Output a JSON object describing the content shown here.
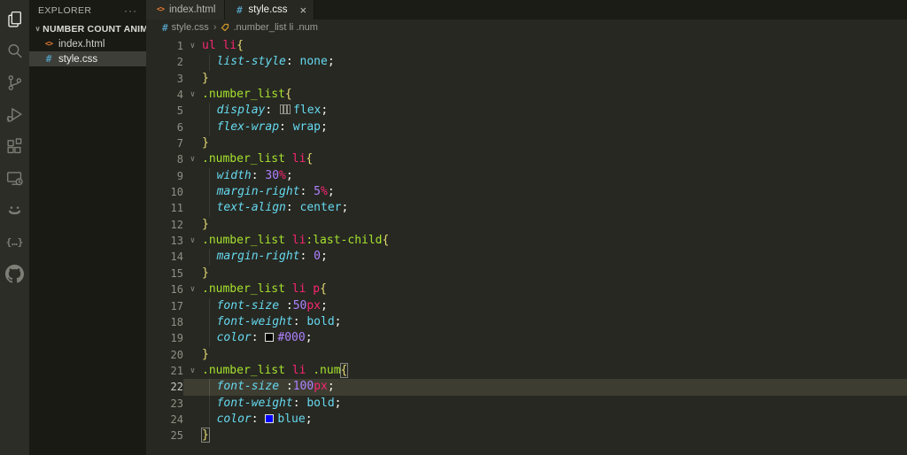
{
  "glyphs": {
    "css": "#",
    "html": "<>"
  },
  "colors": {
    "editor_bg": "#272822",
    "activity_bar_bg": "#2c2d27",
    "sidebar_bg": "#191a14",
    "line_highlight": "#3e3d32",
    "tag": "#f92672",
    "class": "#a6e22e",
    "bracket": "#e6db74",
    "property": "#66d9ef",
    "value_keyword": "#66d9ef",
    "number": "#ae81ff",
    "unit": "#f92672",
    "css_icon_blue": "#519aba",
    "html_icon_orange": "#e37933",
    "swatch_black": "#000000",
    "swatch_blue": "#0000ff"
  },
  "activity_bar": {
    "items": [
      {
        "name": "explorer",
        "active": true
      },
      {
        "name": "search",
        "active": false
      },
      {
        "name": "source-control",
        "active": false
      },
      {
        "name": "run-debug",
        "active": false
      },
      {
        "name": "extensions",
        "active": false
      },
      {
        "name": "live-server",
        "active": false
      },
      {
        "name": "smiley",
        "active": false
      },
      {
        "name": "braces",
        "active": false
      },
      {
        "name": "github",
        "active": false
      }
    ]
  },
  "sidebar": {
    "header": "EXPLORER",
    "more_label": "···",
    "folder": {
      "chevron": "∨",
      "name": "NUMBER COUNT ANIMA..."
    },
    "files": [
      {
        "name": "index.html",
        "icon": "html",
        "selected": false
      },
      {
        "name": "style.css",
        "icon": "css",
        "selected": true
      }
    ]
  },
  "tabs": [
    {
      "label": "index.html",
      "icon": "html",
      "active": false,
      "close_label": ""
    },
    {
      "label": "style.css",
      "icon": "css",
      "active": true,
      "close_label": "×"
    }
  ],
  "breadcrumb": {
    "file": "style.css",
    "separator": "›",
    "path": ".number_list li .num"
  },
  "editor": {
    "active_line": 22,
    "fold_glyph": "∨",
    "lines": [
      {
        "n": 1,
        "fold": true,
        "ind": false,
        "tokens": [
          [
            "tag",
            "ul li"
          ],
          [
            "brk",
            "{"
          ]
        ]
      },
      {
        "n": 2,
        "fold": false,
        "ind": true,
        "tokens": [
          [
            "prop",
            "list-style"
          ],
          [
            "pun",
            ": "
          ],
          [
            "val",
            "none"
          ],
          [
            "pun",
            ";"
          ]
        ]
      },
      {
        "n": 3,
        "fold": false,
        "ind": false,
        "tokens": [
          [
            "brk",
            "}"
          ]
        ]
      },
      {
        "n": 4,
        "fold": true,
        "ind": false,
        "tokens": [
          [
            "cls",
            ".number_list"
          ],
          [
            "brk",
            "{"
          ]
        ]
      },
      {
        "n": 5,
        "fold": false,
        "ind": true,
        "tokens": [
          [
            "prop",
            "display"
          ],
          [
            "pun",
            ": "
          ],
          [
            "flexicon",
            ""
          ],
          [
            "val",
            "flex"
          ],
          [
            "pun",
            ";"
          ]
        ]
      },
      {
        "n": 6,
        "fold": false,
        "ind": true,
        "tokens": [
          [
            "prop",
            "flex-wrap"
          ],
          [
            "pun",
            ": "
          ],
          [
            "val",
            "wrap"
          ],
          [
            "pun",
            ";"
          ]
        ]
      },
      {
        "n": 7,
        "fold": false,
        "ind": false,
        "tokens": [
          [
            "brk",
            "}"
          ]
        ]
      },
      {
        "n": 8,
        "fold": true,
        "ind": false,
        "tokens": [
          [
            "cls",
            ".number_list"
          ],
          [
            "pun",
            " "
          ],
          [
            "tag",
            "li"
          ],
          [
            "brk",
            "{"
          ]
        ]
      },
      {
        "n": 9,
        "fold": false,
        "ind": true,
        "tokens": [
          [
            "prop",
            "width"
          ],
          [
            "pun",
            ": "
          ],
          [
            "num",
            "30"
          ],
          [
            "unit",
            "%"
          ],
          [
            "pun",
            ";"
          ]
        ]
      },
      {
        "n": 10,
        "fold": false,
        "ind": true,
        "tokens": [
          [
            "prop",
            "margin-right"
          ],
          [
            "pun",
            ": "
          ],
          [
            "num",
            "5"
          ],
          [
            "unit",
            "%"
          ],
          [
            "pun",
            ";"
          ]
        ]
      },
      {
        "n": 11,
        "fold": false,
        "ind": true,
        "tokens": [
          [
            "prop",
            "text-align"
          ],
          [
            "pun",
            ": "
          ],
          [
            "val",
            "center"
          ],
          [
            "pun",
            ";"
          ]
        ]
      },
      {
        "n": 12,
        "fold": false,
        "ind": false,
        "tokens": [
          [
            "brk",
            "}"
          ]
        ]
      },
      {
        "n": 13,
        "fold": true,
        "ind": false,
        "tokens": [
          [
            "cls",
            ".number_list"
          ],
          [
            "pun",
            " "
          ],
          [
            "tag",
            "li"
          ],
          [
            "cls",
            ":last-child"
          ],
          [
            "brk",
            "{"
          ]
        ]
      },
      {
        "n": 14,
        "fold": false,
        "ind": true,
        "tokens": [
          [
            "prop",
            "margin-right"
          ],
          [
            "pun",
            ": "
          ],
          [
            "num",
            "0"
          ],
          [
            "pun",
            ";"
          ]
        ]
      },
      {
        "n": 15,
        "fold": false,
        "ind": false,
        "tokens": [
          [
            "brk",
            "}"
          ]
        ]
      },
      {
        "n": 16,
        "fold": true,
        "ind": false,
        "tokens": [
          [
            "cls",
            ".number_list"
          ],
          [
            "pun",
            " "
          ],
          [
            "tag",
            "li"
          ],
          [
            "pun",
            " "
          ],
          [
            "tag",
            "p"
          ],
          [
            "brk",
            "{"
          ]
        ]
      },
      {
        "n": 17,
        "fold": false,
        "ind": true,
        "tokens": [
          [
            "prop",
            "font-size"
          ],
          [
            "pun",
            " :"
          ],
          [
            "num",
            "50"
          ],
          [
            "unit",
            "px"
          ],
          [
            "pun",
            ";"
          ]
        ]
      },
      {
        "n": 18,
        "fold": false,
        "ind": true,
        "tokens": [
          [
            "prop",
            "font-weight"
          ],
          [
            "pun",
            ": "
          ],
          [
            "val",
            "bold"
          ],
          [
            "pun",
            ";"
          ]
        ]
      },
      {
        "n": 19,
        "fold": false,
        "ind": true,
        "tokens": [
          [
            "prop",
            "color"
          ],
          [
            "pun",
            ": "
          ],
          [
            "swatch",
            "#000000"
          ],
          [
            "num",
            "#000"
          ],
          [
            "pun",
            ";"
          ]
        ]
      },
      {
        "n": 20,
        "fold": false,
        "ind": false,
        "tokens": [
          [
            "brk",
            "}"
          ]
        ]
      },
      {
        "n": 21,
        "fold": true,
        "ind": false,
        "tokens": [
          [
            "cls",
            ".number_list"
          ],
          [
            "pun",
            " "
          ],
          [
            "tag",
            "li"
          ],
          [
            "pun",
            " "
          ],
          [
            "cls",
            ".num"
          ],
          [
            "brkbox",
            "{"
          ]
        ]
      },
      {
        "n": 22,
        "fold": false,
        "ind": true,
        "tokens": [
          [
            "prop",
            "font-size"
          ],
          [
            "pun",
            " :"
          ],
          [
            "num",
            "100"
          ],
          [
            "unit",
            "px"
          ],
          [
            "pun",
            ";"
          ]
        ]
      },
      {
        "n": 23,
        "fold": false,
        "ind": true,
        "tokens": [
          [
            "prop",
            "font-weight"
          ],
          [
            "pun",
            ": "
          ],
          [
            "val",
            "bold"
          ],
          [
            "pun",
            ";"
          ]
        ]
      },
      {
        "n": 24,
        "fold": false,
        "ind": true,
        "tokens": [
          [
            "prop",
            "color"
          ],
          [
            "pun",
            ": "
          ],
          [
            "swatch",
            "#0000ff"
          ],
          [
            "val",
            "blue"
          ],
          [
            "pun",
            ";"
          ]
        ]
      },
      {
        "n": 25,
        "fold": false,
        "ind": false,
        "tokens": [
          [
            "brkbox",
            "}"
          ]
        ]
      }
    ]
  }
}
